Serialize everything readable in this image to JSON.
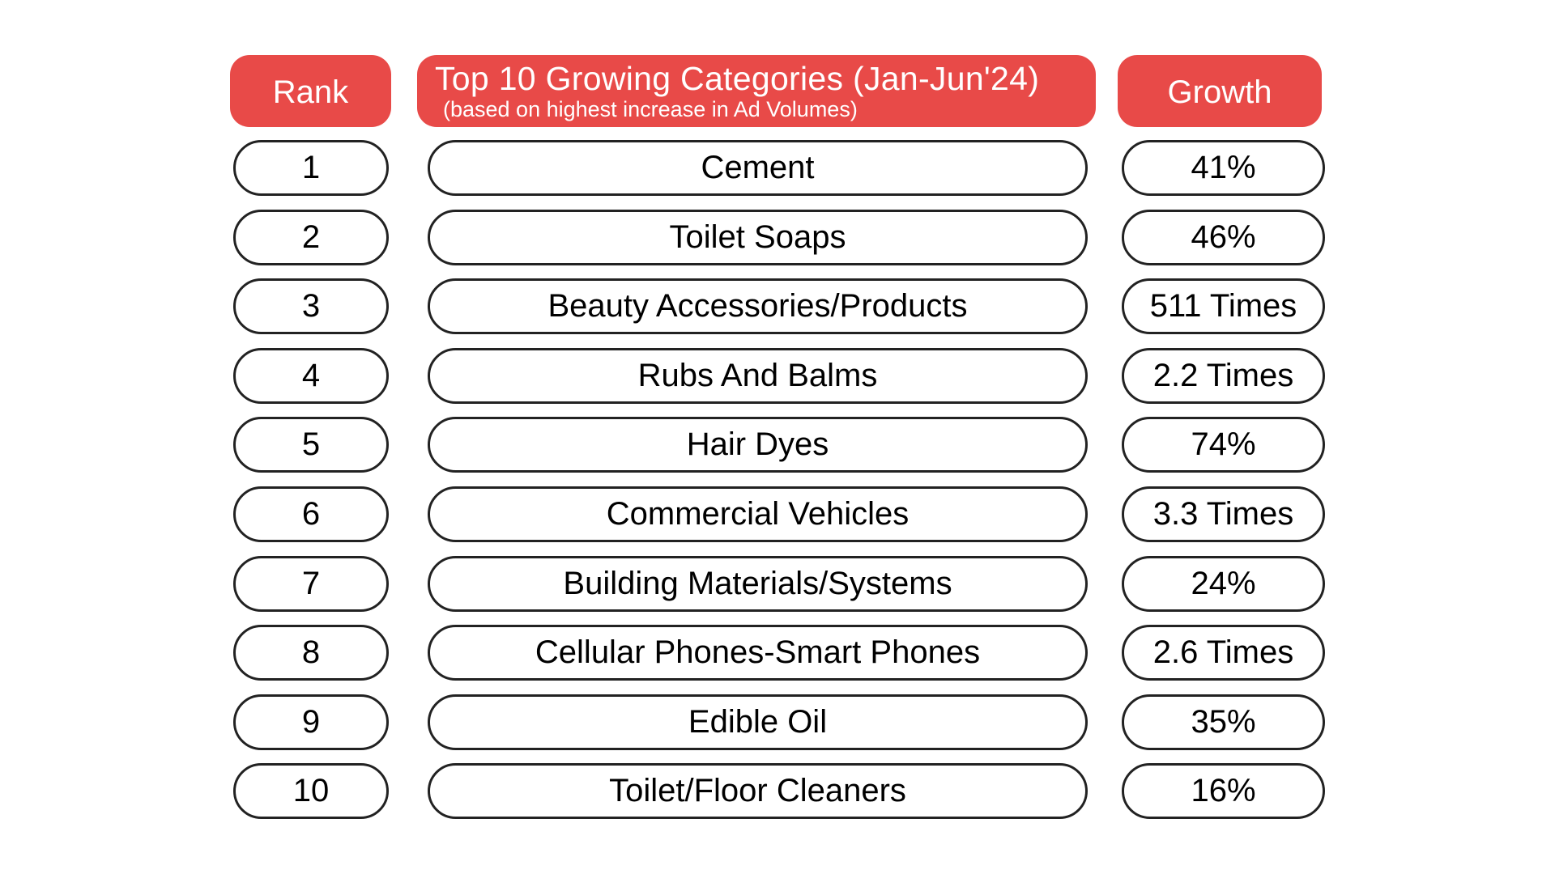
{
  "header": {
    "rank_label": "Rank",
    "title": "Top 10 Growing Categories (Jan-Jun'24)",
    "subtitle": "(based on highest increase in Ad Volumes)",
    "growth_label": "Growth"
  },
  "colors": {
    "header_bg": "#E84A48",
    "header_text": "#FFFFFF",
    "pill_border": "#222222",
    "text": "#000000"
  },
  "rows": [
    {
      "rank": "1",
      "category": "Cement",
      "growth": "41%"
    },
    {
      "rank": "2",
      "category": "Toilet Soaps",
      "growth": "46%"
    },
    {
      "rank": "3",
      "category": "Beauty Accessories/Products",
      "growth": "511 Times"
    },
    {
      "rank": "4",
      "category": "Rubs And Balms",
      "growth": "2.2 Times"
    },
    {
      "rank": "5",
      "category": "Hair Dyes",
      "growth": "74%"
    },
    {
      "rank": "6",
      "category": "Commercial Vehicles",
      "growth": "3.3 Times"
    },
    {
      "rank": "7",
      "category": "Building Materials/Systems",
      "growth": "24%"
    },
    {
      "rank": "8",
      "category": "Cellular Phones-Smart Phones",
      "growth": "2.6 Times"
    },
    {
      "rank": "9",
      "category": "Edible Oil",
      "growth": "35%"
    },
    {
      "rank": "10",
      "category": "Toilet/Floor Cleaners",
      "growth": "16%"
    }
  ]
}
